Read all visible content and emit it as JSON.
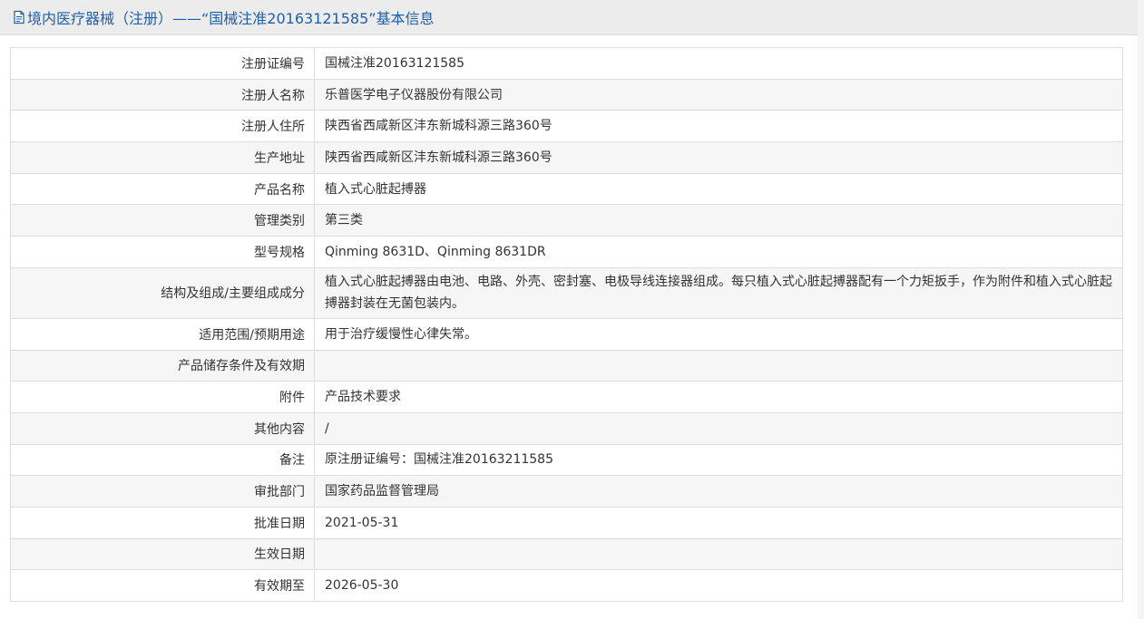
{
  "header": {
    "title": "境内医疗器械（注册）——“国械注准20163121585”基本信息",
    "icon": "document-icon",
    "title_color": "#1f5fa8"
  },
  "rows": [
    {
      "label": "注册证编号",
      "value": "国械注准20163121585"
    },
    {
      "label": "注册人名称",
      "value": "乐普医学电子仪器股份有限公司"
    },
    {
      "label": "注册人住所",
      "value": "陕西省西咸新区沣东新城科源三路360号"
    },
    {
      "label": "生产地址",
      "value": "陕西省西咸新区沣东新城科源三路360号"
    },
    {
      "label": "产品名称",
      "value": "植入式心脏起搏器"
    },
    {
      "label": "管理类别",
      "value": "第三类"
    },
    {
      "label": "型号规格",
      "value": "Qinming 8631D、Qinming 8631DR"
    },
    {
      "label": "结构及组成/主要组成成分",
      "value": "植入式心脏起搏器由电池、电路、外壳、密封塞、电极导线连接器组成。每只植入式心脏起搏器配有一个力矩扳手，作为附件和植入式心脏起搏器封装在无菌包装内。"
    },
    {
      "label": "适用范围/预期用途",
      "value": "用于治疗缓慢性心律失常。"
    },
    {
      "label": "产品储存条件及有效期",
      "value": ""
    },
    {
      "label": "附件",
      "value": "产品技术要求"
    },
    {
      "label": "其他内容",
      "value": "/"
    },
    {
      "label": "备注",
      "value": "原注册证编号：国械注准20163211585"
    },
    {
      "label": "审批部门",
      "value": "国家药品监督管理局"
    },
    {
      "label": "批准日期",
      "value": "2021-05-31"
    },
    {
      "label": "生效日期",
      "value": ""
    },
    {
      "label": "有效期至",
      "value": "2026-05-30"
    }
  ]
}
